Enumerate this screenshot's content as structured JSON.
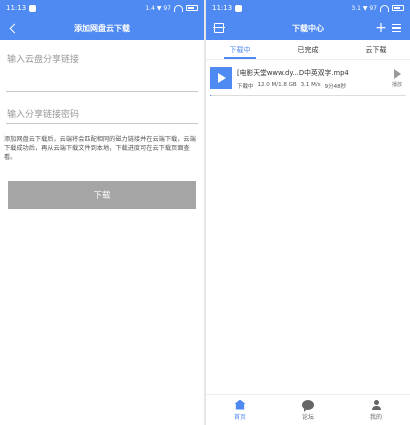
{
  "left": {
    "status_time": "11:13",
    "status_right": "1.4 ▼ 97",
    "title": "添加网盘云下载",
    "link_placeholder": "输入云盘分享链接",
    "password_placeholder": "输入分享链接密码",
    "hint": "添加网盘云下载后，云端将会匹配相同的磁力链接并在云端下载，云端下载成功后，再从云端下载文件到本地，下载进度可在云下载页面查看。",
    "download_label": "下载"
  },
  "right": {
    "status_time": "11:13",
    "status_right": "3.1 ▼ 97",
    "title": "下载中心",
    "tabs": [
      {
        "label": "下载中"
      },
      {
        "label": "已完成"
      },
      {
        "label": "云下载"
      }
    ],
    "task": {
      "name": "[电影天堂www.dy...D中英双字.mp4",
      "status": "下载中",
      "size": "12.0 M/1.8 GB",
      "speed": "3.1 M/s",
      "eta": "9分48秒",
      "action_label": "播放",
      "progress": 0.0067
    },
    "nav": [
      {
        "label": "首页",
        "icon": "home-icon"
      },
      {
        "label": "论坛",
        "icon": "forum-icon"
      },
      {
        "label": "我的",
        "icon": "person-icon"
      }
    ]
  },
  "colors": {
    "accent": "#4f8af2",
    "button_disabled": "#a5a5a5"
  }
}
